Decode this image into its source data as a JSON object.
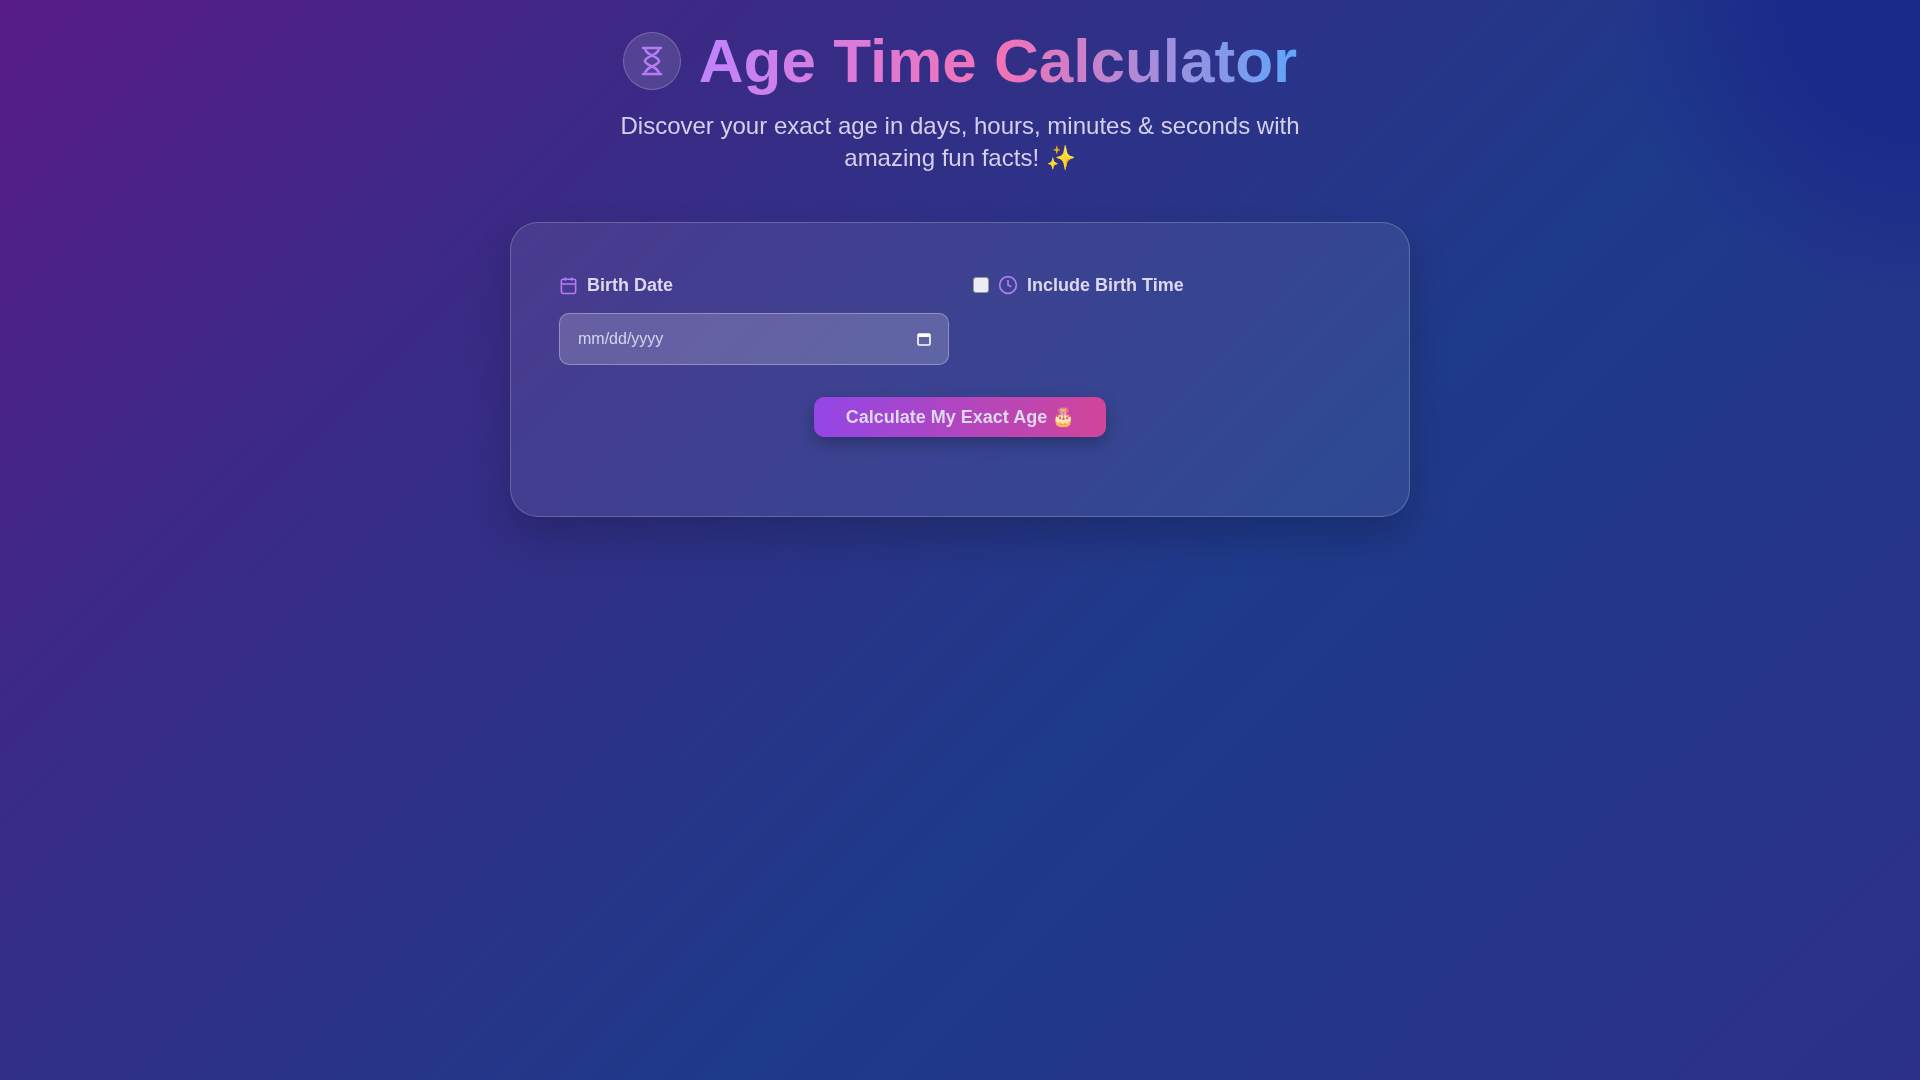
{
  "header": {
    "title": "Age Time Calculator",
    "subtitle": "Discover your exact age in days, hours, minutes & seconds with amazing fun facts! ✨"
  },
  "form": {
    "birth_date": {
      "label": "Birth Date",
      "placeholder": "mm/dd/yyyy"
    },
    "birth_time": {
      "label": "Include Birth Time",
      "checked": false
    },
    "button": "Calculate My Exact Age 🎂"
  }
}
